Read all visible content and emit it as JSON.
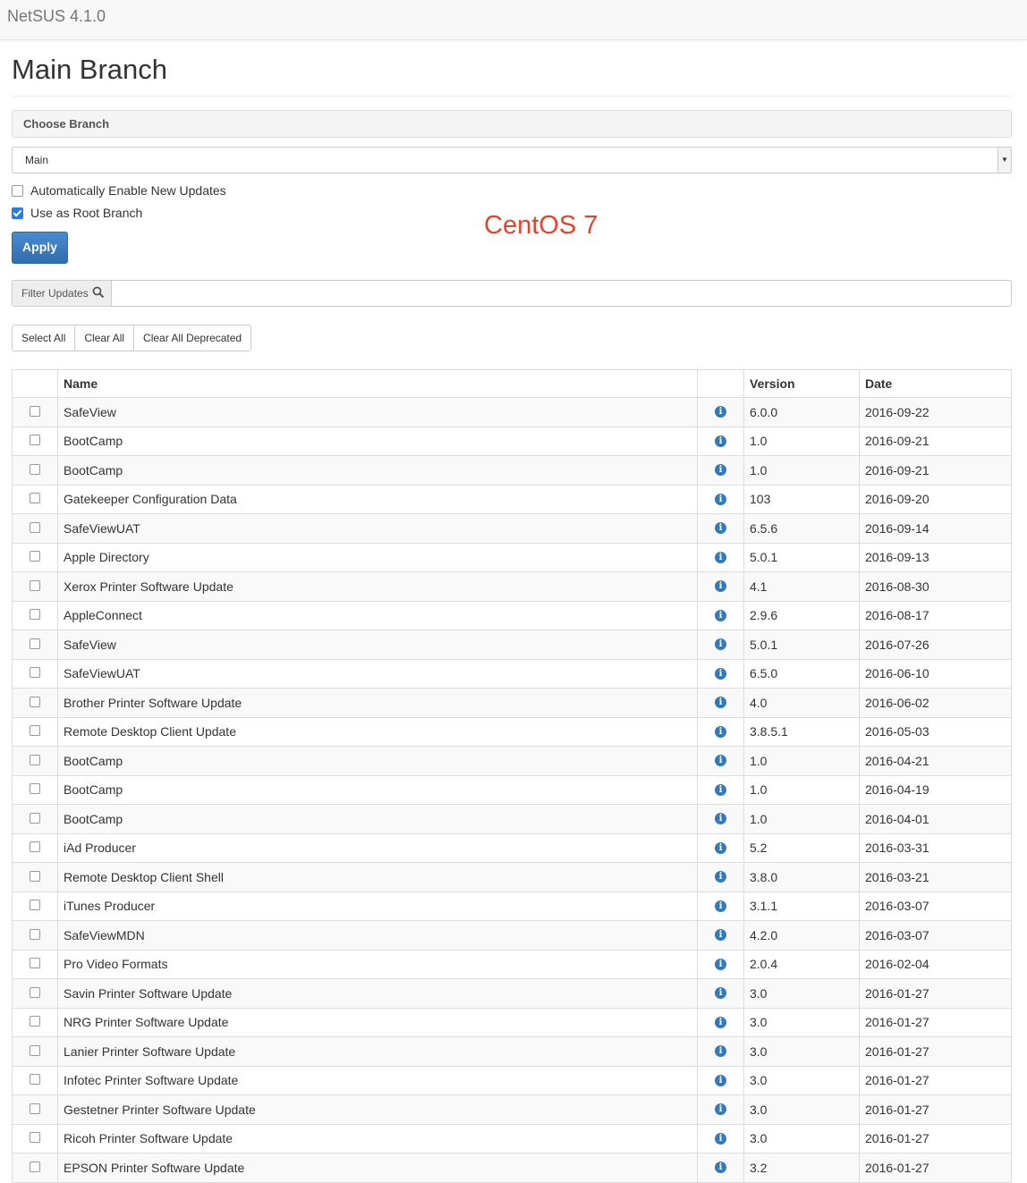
{
  "navbar": {
    "brand": "NetSUS 4.1.0"
  },
  "page": {
    "title": "Main Branch"
  },
  "branch_panel": {
    "heading": "Choose Branch",
    "selected_branch": "Main"
  },
  "options": {
    "auto_enable_label": "Automatically Enable New Updates",
    "auto_enable_checked": false,
    "root_branch_label": "Use as Root Branch",
    "root_branch_checked": true
  },
  "apply_label": "Apply",
  "overlay_label": "CentOS 7",
  "filter": {
    "label": "Filter Updates",
    "value": ""
  },
  "bulk_actions": {
    "select_all": "Select All",
    "clear_all": "Clear All",
    "clear_deprecated": "Clear All Deprecated"
  },
  "table": {
    "headers": {
      "name": "Name",
      "info": "",
      "version": "Version",
      "date": "Date"
    },
    "rows": [
      {
        "name": "SafeView",
        "version": "6.0.0",
        "date": "2016-09-22"
      },
      {
        "name": "BootCamp",
        "version": "1.0",
        "date": "2016-09-21"
      },
      {
        "name": "BootCamp",
        "version": "1.0",
        "date": "2016-09-21"
      },
      {
        "name": "Gatekeeper Configuration Data",
        "version": "103",
        "date": "2016-09-20"
      },
      {
        "name": "SafeViewUAT",
        "version": "6.5.6",
        "date": "2016-09-14"
      },
      {
        "name": "Apple Directory",
        "version": "5.0.1",
        "date": "2016-09-13"
      },
      {
        "name": "Xerox Printer Software Update",
        "version": "4.1",
        "date": "2016-08-30"
      },
      {
        "name": "AppleConnect",
        "version": "2.9.6",
        "date": "2016-08-17"
      },
      {
        "name": "SafeView",
        "version": "5.0.1",
        "date": "2016-07-26"
      },
      {
        "name": "SafeViewUAT",
        "version": "6.5.0",
        "date": "2016-06-10"
      },
      {
        "name": "Brother Printer Software Update",
        "version": "4.0",
        "date": "2016-06-02"
      },
      {
        "name": "Remote Desktop Client Update",
        "version": "3.8.5.1",
        "date": "2016-05-03"
      },
      {
        "name": "BootCamp",
        "version": "1.0",
        "date": "2016-04-21"
      },
      {
        "name": "BootCamp",
        "version": "1.0",
        "date": "2016-04-19"
      },
      {
        "name": "BootCamp",
        "version": "1.0",
        "date": "2016-04-01"
      },
      {
        "name": "iAd Producer",
        "version": "5.2",
        "date": "2016-03-31"
      },
      {
        "name": "Remote Desktop Client Shell",
        "version": "3.8.0",
        "date": "2016-03-21"
      },
      {
        "name": "iTunes Producer",
        "version": "3.1.1",
        "date": "2016-03-07"
      },
      {
        "name": "SafeViewMDN",
        "version": "4.2.0",
        "date": "2016-03-07"
      },
      {
        "name": "Pro Video Formats",
        "version": "2.0.4",
        "date": "2016-02-04"
      },
      {
        "name": "Savin Printer Software Update",
        "version": "3.0",
        "date": "2016-01-27"
      },
      {
        "name": "NRG Printer Software Update",
        "version": "3.0",
        "date": "2016-01-27"
      },
      {
        "name": "Lanier Printer Software Update",
        "version": "3.0",
        "date": "2016-01-27"
      },
      {
        "name": "Infotec Printer Software Update",
        "version": "3.0",
        "date": "2016-01-27"
      },
      {
        "name": "Gestetner Printer Software Update",
        "version": "3.0",
        "date": "2016-01-27"
      },
      {
        "name": "Ricoh Printer Software Update",
        "version": "3.0",
        "date": "2016-01-27"
      },
      {
        "name": "EPSON Printer Software Update",
        "version": "3.2",
        "date": "2016-01-27"
      }
    ]
  },
  "icons": {
    "info": "info-circle-icon",
    "search": "search-icon",
    "dropdown": "caret-down-icon"
  },
  "colors": {
    "primary": "#337ab7",
    "overlay_text": "#e0452f"
  }
}
